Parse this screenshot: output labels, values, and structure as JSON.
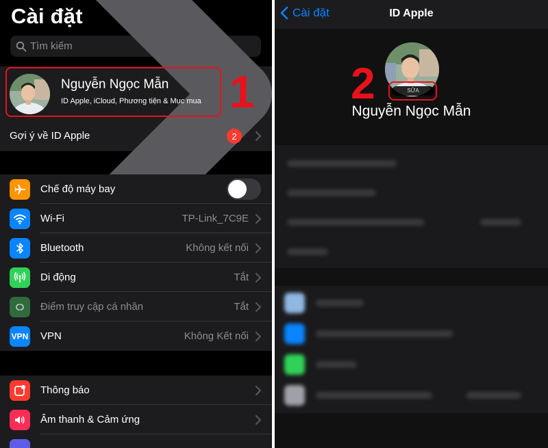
{
  "left": {
    "title": "Cài đặt",
    "search_placeholder": "Tìm kiếm",
    "profile": {
      "name": "Nguyễn Ngọc Mẫn",
      "subtitle": "ID Apple, iCloud, Phương tiện & Mục mua"
    },
    "step_one": "1",
    "suggestion": {
      "label": "Gợi ý về ID Apple",
      "badge": "2"
    },
    "connectivity": [
      {
        "label": "Chế độ máy bay",
        "value": "",
        "icon": "airplane-icon",
        "color": "#ff9500"
      },
      {
        "label": "Wi-Fi",
        "value": "TP-Link_7C9E",
        "icon": "wifi-icon",
        "color": "#0a84ff"
      },
      {
        "label": "Bluetooth",
        "value": "Không kết nối",
        "icon": "bluetooth-icon",
        "color": "#0a84ff"
      },
      {
        "label": "Di động",
        "value": "Tắt",
        "icon": "cellular-icon",
        "color": "#30d158"
      },
      {
        "label": "Điểm truy cập cá nhân",
        "value": "Tắt",
        "icon": "hotspot-icon",
        "color": "#30d158"
      },
      {
        "label": "VPN",
        "value": "Không Kết nối",
        "icon": "vpn-icon",
        "icon_text": "VPN",
        "color": "#0a84ff"
      }
    ],
    "notifications": [
      {
        "label": "Thông báo",
        "icon": "notification-icon",
        "color": "#ff3b30"
      },
      {
        "label": "Âm thanh & Cảm ứng",
        "icon": "sound-icon",
        "color": "#ff2d55"
      }
    ]
  },
  "right": {
    "back_label": "Cài đặt",
    "title": "ID Apple",
    "edit_label": "SỬA",
    "name": "Nguyễn Ngọc Mẫn",
    "step_two": "2"
  },
  "colors": {
    "highlight": "#e8121b",
    "accent": "#0a84ff",
    "background": "#000000",
    "cell": "#1c1c1e"
  }
}
